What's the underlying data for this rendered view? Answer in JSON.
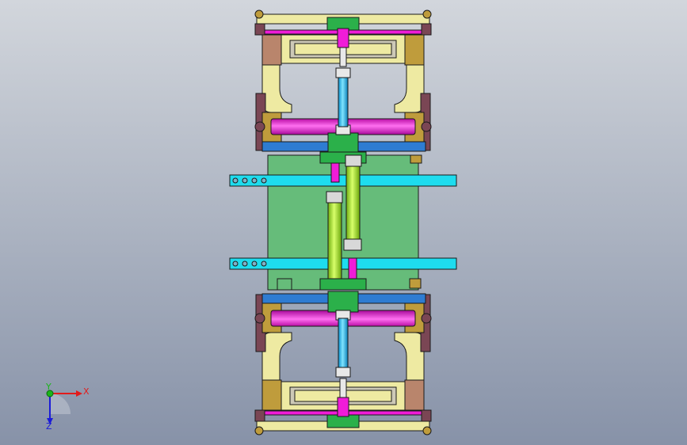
{
  "viewport": {
    "background_top": "#d2d6dc",
    "background_bottom": "#8792a8"
  },
  "colors": {
    "yellow": "#eeeaa2",
    "magenta": "#f01cd8",
    "brown": "#b9856c",
    "olive": "#bf9c3c",
    "gray_plate": "#cdc9b7",
    "dark_maroon": "#7a4654",
    "green": "#66bc7a",
    "lime": "#a6e02e",
    "cyan": "#1edcee",
    "blue": "#2e7cd2",
    "sky_cylinder": "#1fb2ee",
    "outline": "#1a1a1a"
  },
  "triad": {
    "x_label": "X",
    "y_label": "Y",
    "z_label": "Z",
    "x_color": "#e21b1b",
    "y_color": "#1bb51b",
    "z_color": "#1b1bd8"
  }
}
